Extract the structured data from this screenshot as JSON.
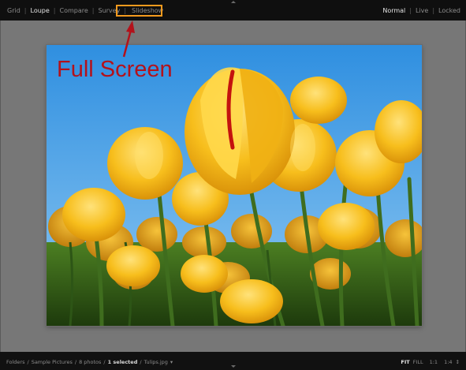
{
  "top_bar": {
    "view_modes": [
      {
        "label": "Grid",
        "active": false
      },
      {
        "label": "Loupe",
        "active": true
      },
      {
        "label": "Compare",
        "active": false
      },
      {
        "label": "Survey",
        "active": false
      },
      {
        "label": "Slideshow",
        "active": false
      }
    ],
    "screen_modes": [
      {
        "label": "Normal",
        "active": true
      },
      {
        "label": "Live",
        "active": false
      },
      {
        "label": "Locked",
        "active": false
      }
    ],
    "separator": "|"
  },
  "annotation": {
    "text": "Full Screen",
    "color": "#b3121b",
    "highlight_color": "#f39a1e"
  },
  "photo": {
    "subject": "yellow tulips against blue sky",
    "sky_color": "#3f9fe6",
    "petal_color": "#f3b81a",
    "stem_color": "#3c6a1e"
  },
  "bottom_bar": {
    "breadcrumb": {
      "folders": "Folders",
      "sample": "Sample Pictures",
      "count": "8 photos",
      "selected": "1 selected",
      "file": "Tulips.jpg",
      "separator": "/",
      "dropdown_arrow": "▾"
    },
    "zoom_levels": [
      {
        "label": "FIT",
        "active": true
      },
      {
        "label": "FILL",
        "active": false
      },
      {
        "label": "1:1",
        "active": false
      },
      {
        "label": "1:4",
        "active": false
      }
    ],
    "zoom_dropdown_icon": "↕"
  }
}
